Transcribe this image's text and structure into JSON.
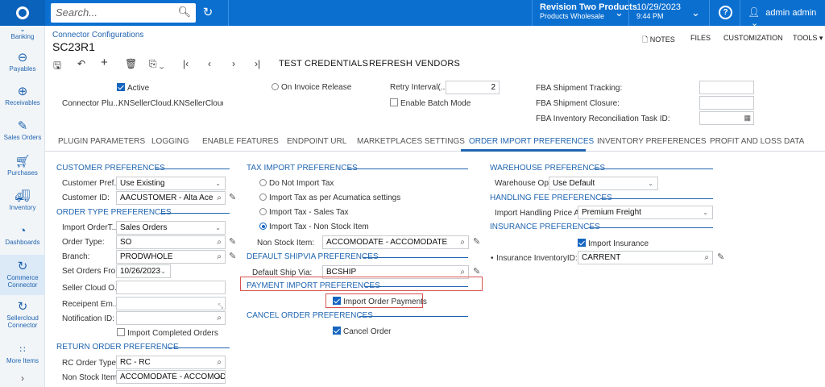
{
  "topbar": {
    "search_placeholder": "Search...",
    "company_line1": "Revision Two Products",
    "company_line2": "Products Wholesale",
    "date": "10/29/2023",
    "time": "9:44 PM",
    "help": "?",
    "user": "admin admin"
  },
  "nav": {
    "banking": "Banking",
    "payables": "Payables",
    "receivables": "Receivables",
    "sales_orders": "Sales Orders",
    "purchases": "Purchases",
    "inventory": "Inventory",
    "dashboards": "Dashboards",
    "commerce_connector_1": "Commerce",
    "commerce_connector_2": "Connector",
    "sellercloud_1": "Sellercloud",
    "sellercloud_2": "Connector",
    "more_items": "More Items"
  },
  "header": {
    "breadcrumb": "Connector Configurations",
    "title": "SC23R1",
    "notes": "NOTES",
    "files": "FILES",
    "customization": "CUSTOMIZATION",
    "tools": "TOOLS"
  },
  "toolbar": {
    "test_credentials": "TEST CREDENTIALS",
    "refresh_vendors": "REFRESH VENDORS"
  },
  "form": {
    "active": "Active",
    "connector_plugin_label": "Connector Plu...",
    "connector_plugin_value": "KNSellerCloud.KNSellerCloudCo",
    "on_invoice_release": "On Invoice Release",
    "retry_interval_label": "Retry Interval(...",
    "retry_interval_value": "2",
    "enable_batch_mode": "Enable Batch Mode",
    "fba_shipment_tracking": "FBA Shipment Tracking:",
    "fba_shipment_closure": "FBA Shipment Closure:",
    "fba_inventory_recon": "FBA Inventory Reconciliation Task ID:"
  },
  "tabs": [
    "PLUGIN PARAMETERS",
    "LOGGING",
    "ENABLE FEATURES",
    "ENDPOINT URL",
    "MARKETPLACES SETTINGS",
    "ORDER IMPORT PREFERENCES",
    "INVENTORY PREFERENCES",
    "PROFIT AND LOSS DATA"
  ],
  "customer": {
    "header": "CUSTOMER PREFERENCES",
    "pref_label": "Customer Pref...",
    "pref_value": "Use Existing",
    "id_label": "Customer ID:",
    "id_value": "AACUSTOMER - Alta Ace"
  },
  "order_type": {
    "header": "ORDER TYPE PREFERENCES",
    "import_label": "Import OrderT...",
    "import_value": "Sales Orders",
    "order_type_label": "Order Type:",
    "order_type_value": "SO",
    "branch_label": "Branch:",
    "branch_value": "PRODWHOLE",
    "set_orders_label": "Set Orders Fro...",
    "set_orders_value": "10/26/2023",
    "seller_cloud_label": "Seller Cloud O...",
    "receipent_label": "Receipent Em...",
    "notification_label": "Notification ID:",
    "import_completed": "Import Completed Orders"
  },
  "return_order": {
    "header": "RETURN ORDER PREFERENCE",
    "rc_label": "RC Order Type:",
    "rc_value": "RC - RC",
    "nonstock_label": "Non Stock Item:",
    "nonstock_value": "ACCOMODATE - ACCOMOD"
  },
  "tax": {
    "header": "TAX IMPORT PREFERENCES",
    "opt1": "Do Not Import Tax",
    "opt2": "Import Tax as per Acumatica settings",
    "opt3": "Import Tax - Sales Tax",
    "opt4": "Import Tax - Non Stock Item",
    "nonstock_label": "Non Stock Item:",
    "nonstock_value": "ACCOMODATE - ACCOMODATE"
  },
  "shipvia": {
    "header": "DEFAULT SHIPVIA PREFERENCES",
    "label": "Default Ship Via:",
    "value": "BCSHIP"
  },
  "payment": {
    "header": "PAYMENT IMPORT PREFERENCES",
    "import_payments": "Import Order Payments"
  },
  "cancel": {
    "header": "CANCEL ORDER PREFERENCES",
    "cancel_order": "Cancel Order"
  },
  "warehouse": {
    "header": "WAREHOUSE PREFERENCES",
    "label": "Warehouse Op...",
    "value": "Use Default"
  },
  "handling": {
    "header": "HANDLING FEE PREFERENCES",
    "label": "Import Handling Price As:",
    "value": "Premium Freight"
  },
  "insurance": {
    "header": "INSURANCE PREFERENCES",
    "import_insurance": "Import Insurance",
    "inv_label": "Insurance InventoryID:",
    "inv_value": "CARRENT"
  }
}
